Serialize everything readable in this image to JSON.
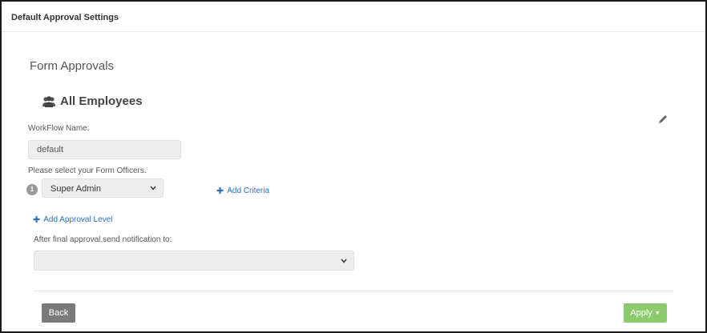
{
  "panel": {
    "title": "Default Approval Settings"
  },
  "section": {
    "title": "Form Approvals"
  },
  "group": {
    "title": "All Employees",
    "icon": "users-icon"
  },
  "workflow": {
    "label": "WorkFlow Name:",
    "value": "default"
  },
  "officers": {
    "label": "Please select your Form Officers.",
    "levels": [
      {
        "step": "1",
        "selected": "Super Admin"
      }
    ],
    "add_criteria": "Add Criteria"
  },
  "add_level": "Add Approval Level",
  "notification": {
    "label": "After final approval,send notification to:",
    "selected": ""
  },
  "buttons": {
    "back": "Back",
    "apply": "Apply"
  },
  "colors": {
    "link": "#2a6fbf",
    "apply": "#8ccb6d",
    "back": "#7a7a7a"
  }
}
